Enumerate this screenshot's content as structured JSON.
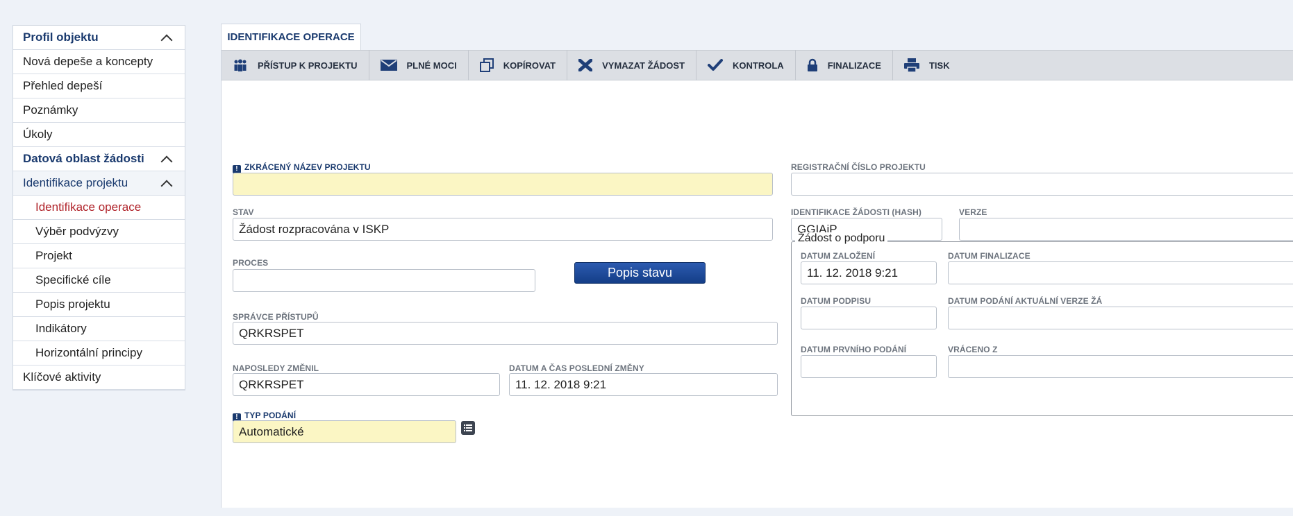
{
  "sidebar": {
    "items": [
      {
        "label": "Profil objektu"
      },
      {
        "label": "Nová depeše a koncepty"
      },
      {
        "label": "Přehled depeší"
      },
      {
        "label": "Poznámky"
      },
      {
        "label": "Úkoly"
      },
      {
        "label": "Datová oblast žádosti"
      },
      {
        "label": "Identifikace projektu"
      },
      {
        "label": "Identifikace operace"
      },
      {
        "label": "Výběr podvýzvy"
      },
      {
        "label": "Projekt"
      },
      {
        "label": "Specifické cíle"
      },
      {
        "label": "Popis projektu"
      },
      {
        "label": "Indikátory"
      },
      {
        "label": "Horizontální principy"
      },
      {
        "label": "Klíčové aktivity"
      }
    ]
  },
  "tab": {
    "label": "IDENTIFIKACE OPERACE"
  },
  "toolbar": {
    "buttons": [
      {
        "label": "PŘÍSTUP K PROJEKTU",
        "icon": "people-icon"
      },
      {
        "label": "PLNÉ MOCI",
        "icon": "envelope-icon"
      },
      {
        "label": "KOPÍROVAT",
        "icon": "copy-icon"
      },
      {
        "label": "VYMAZAT ŽÁDOST",
        "icon": "delete-icon"
      },
      {
        "label": "KONTROLA",
        "icon": "check-icon"
      },
      {
        "label": "FINALIZACE",
        "icon": "lock-icon"
      },
      {
        "label": "TISK",
        "icon": "printer-icon"
      }
    ]
  },
  "form": {
    "zkraceny_nazev": {
      "label": "ZKRÁCENÝ NÁZEV PROJEKTU",
      "value": ""
    },
    "stav": {
      "label": "STAV",
      "value": "Žádost rozpracována v ISKP"
    },
    "proces": {
      "label": "PROCES",
      "value": ""
    },
    "popis_stavu_button": "Popis stavu",
    "spravce": {
      "label": "SPRÁVCE PŘÍSTUPŮ",
      "value": "QRKRSPET"
    },
    "naposledy_zmenil": {
      "label": "NAPOSLEDY ZMĚNIL",
      "value": "QRKRSPET"
    },
    "datum_zmeny": {
      "label": "DATUM A ČAS POSLEDNÍ ZMĚNY",
      "value": "11. 12. 2018 9:21"
    },
    "typ_podani": {
      "label": "TYP PODÁNÍ",
      "value": "Automatické"
    },
    "registracni_cislo": {
      "label": "REGISTRAČNÍ ČÍSLO PROJEKTU",
      "value": ""
    },
    "identifikace_hash": {
      "label": "IDENTIFIKACE ŽÁDOSTI (HASH)",
      "value": "GGIAiP"
    },
    "verze": {
      "label": "VERZE",
      "value": ""
    }
  },
  "zadost_o_podporu": {
    "legend": "Žádost o podporu",
    "datum_zalozeni": {
      "label": "DATUM ZALOŽENÍ",
      "value": "11. 12. 2018 9:21"
    },
    "datum_finalizace": {
      "label": "DATUM FINALIZACE",
      "value": ""
    },
    "datum_podpisu": {
      "label": "DATUM PODPISU",
      "value": ""
    },
    "datum_podani_verze": {
      "label": "DATUM PODÁNÍ AKTUÁLNÍ VERZE ŽÁ",
      "value": ""
    },
    "datum_prvniho_podani": {
      "label": "DATUM PRVNÍHO PODÁNÍ",
      "value": ""
    },
    "vraceno_z": {
      "label": "VRÁCENO Z",
      "value": ""
    }
  },
  "colors": {
    "accent_blue": "#1a3a6e",
    "active_red": "#b0232a",
    "required_yellow": "#fbf6c4",
    "toolbar_gray": "#dcdfe4"
  }
}
